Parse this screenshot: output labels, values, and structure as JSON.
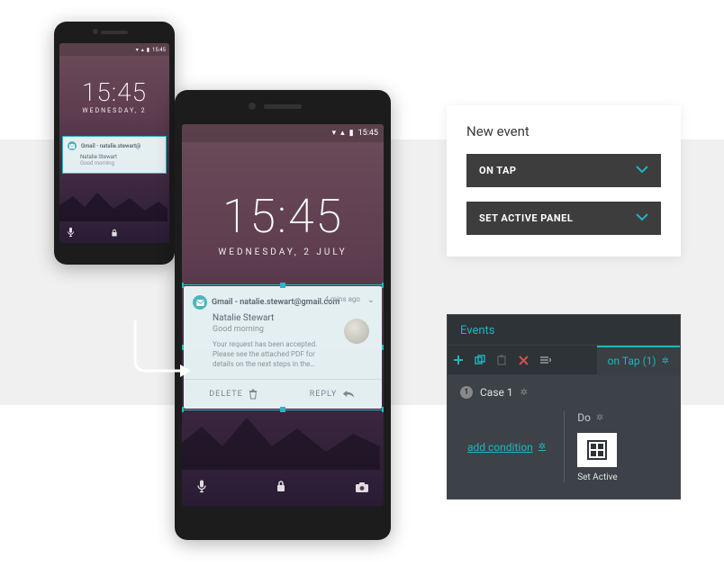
{
  "phone": {
    "statusbar_time": "15:45",
    "clock_time": "15:45",
    "clock_date_short": "WEDNESDAY, 2",
    "clock_date_full": "WEDNESDAY, 2 JULY"
  },
  "notification_collapsed": {
    "sender_line": "Gmail - natalie.stewart@",
    "name": "Natalie Stewart",
    "subject": "Good morning"
  },
  "notification_expanded": {
    "sender_line": "Gmail - natalie.stewart@gmail.com",
    "meta": "4 mins ago",
    "name": "Natalie Stewart",
    "subject": "Good morning",
    "body": "Your request has been accepted. Please see the attached PDF for details on the next steps in the…",
    "action_delete": "DELETE",
    "action_reply": "REPLY"
  },
  "new_event": {
    "title": "New event",
    "trigger": "ON TAP",
    "action": "SET ACTIVE PANEL"
  },
  "events_panel": {
    "header": "Events",
    "tab_label": "on Tap (1)",
    "case_label": "Case 1",
    "add_condition": "add condition",
    "do_label": "Do",
    "action_tile_label": "Set Active"
  }
}
